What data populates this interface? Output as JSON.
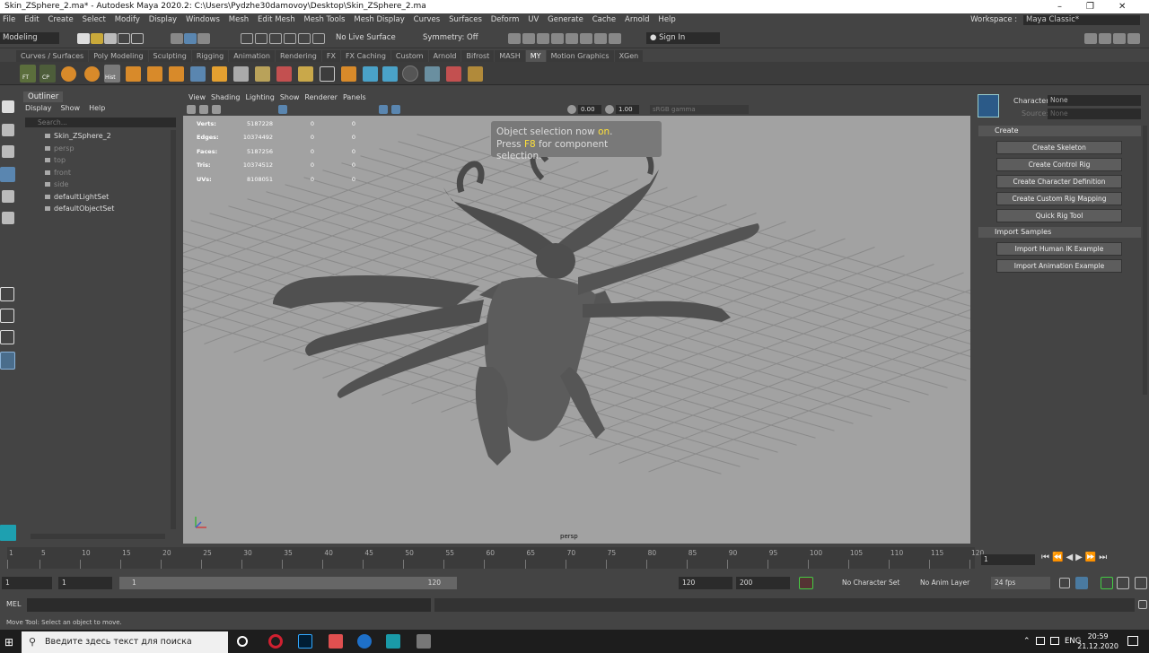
{
  "window": {
    "title": "Skin_ZSphere_2.ma* - Autodesk Maya 2020.2: C:\\Users\\Pydzhe30damovoy\\Desktop\\Skin_ZSphere_2.ma"
  },
  "menus": [
    "File",
    "Edit",
    "Create",
    "Select",
    "Modify",
    "Display",
    "Windows",
    "Mesh",
    "Edit Mesh",
    "Mesh Tools",
    "Mesh Display",
    "Curves",
    "Surfaces",
    "Deform",
    "UV",
    "Generate",
    "Cache",
    "Arnold",
    "Help"
  ],
  "workspace": {
    "label": "Workspace :",
    "value": "Maya Classic*"
  },
  "statusline": {
    "mode": "Modeling",
    "live_surface": "No Live Surface",
    "symmetry": "Symmetry: Off",
    "sign_in": "Sign In"
  },
  "shelf_tabs": [
    "Curves / Surfaces",
    "Poly Modeling",
    "Sculpting",
    "Rigging",
    "Animation",
    "Rendering",
    "FX",
    "FX Caching",
    "Custom",
    "Arnold",
    "Bifrost",
    "MASH",
    "MY",
    "Motion Graphics",
    "XGen"
  ],
  "shelf_labels": {
    "ft": "FT",
    "cp": "CP",
    "hist": "Hist"
  },
  "outliner": {
    "tab": "Outliner",
    "menu": [
      "Display",
      "Show",
      "Help"
    ],
    "search_placeholder": "Search...",
    "items": [
      "Skin_ZSphere_2",
      "persp",
      "top",
      "front",
      "side",
      "defaultLightSet",
      "defaultObjectSet"
    ]
  },
  "viewport": {
    "menu": [
      "View",
      "Shading",
      "Lighting",
      "Show",
      "Renderer",
      "Panels"
    ],
    "exposure": "0.00",
    "gamma": "1.00",
    "color_space": "sRGB gamma",
    "hud": [
      [
        "Verts:",
        "5187228",
        "0",
        "0"
      ],
      [
        "Edges:",
        "10374492",
        "0",
        "0"
      ],
      [
        "Faces:",
        "5187256",
        "0",
        "0"
      ],
      [
        "Tris:",
        "10374512",
        "0",
        "0"
      ],
      [
        "UVs:",
        "8108051",
        "0",
        "0"
      ]
    ],
    "message": {
      "line1a": "Object selection now ",
      "line1b": "on",
      "line1c": ".",
      "line2a": "Press ",
      "line2b": "F8",
      "line2c": " for component selection."
    },
    "camera": "persp"
  },
  "right_panel": {
    "character_label": "Character:",
    "character_value": "None",
    "source_label": "Source:",
    "source_value": "None",
    "create_section": "Create",
    "create_buttons": [
      "Create Skeleton",
      "Create Control Rig",
      "Create Character Definition",
      "Create Custom Rig Mapping",
      "Quick Rig Tool"
    ],
    "import_section": "Import Samples",
    "import_buttons": [
      "Import Human IK Example",
      "Import Animation Example"
    ]
  },
  "timeline": {
    "ticks": [
      "1",
      "5",
      "10",
      "15",
      "20",
      "25",
      "30",
      "35",
      "40",
      "45",
      "50",
      "55",
      "60",
      "65",
      "70",
      "75",
      "80",
      "85",
      "90",
      "95",
      "100",
      "105",
      "110",
      "115",
      "120"
    ],
    "current_frame": "1"
  },
  "range": {
    "start": "1",
    "playback_start": "1",
    "slider_start": "1",
    "slider_end": "120",
    "playback_end": "120",
    "end": "200",
    "character_set": "No Character Set",
    "anim_layer": "No Anim Layer",
    "fps": "24 fps"
  },
  "command": {
    "label": "MEL"
  },
  "help_line": "Move Tool: Select an object to move.",
  "taskbar": {
    "search_placeholder": "Введите здесь текст для поиска",
    "lang": "ENG",
    "time": "20:59",
    "date": "21.12.2020"
  }
}
